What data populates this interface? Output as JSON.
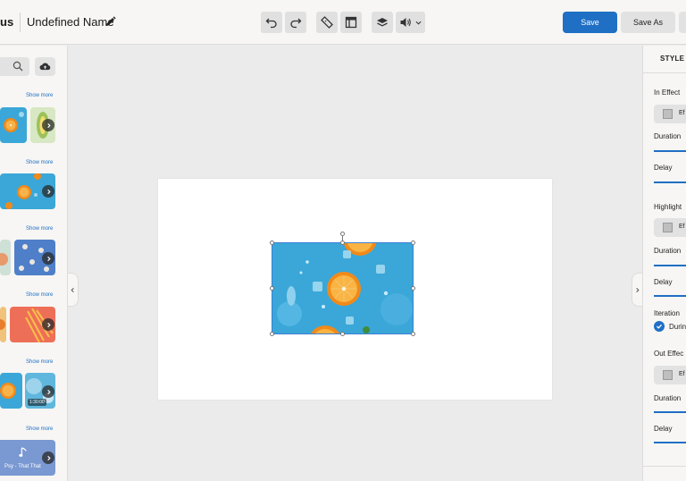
{
  "header": {
    "brand": "us",
    "project_name": "Undefined Name",
    "save_label": "Save",
    "save_as_label": "Save As"
  },
  "toolbar": {
    "icons": [
      "undo-icon",
      "redo-icon",
      "ruler-icon",
      "layout-icon",
      "layers-icon",
      "volume-icon",
      "chevron-down-icon"
    ]
  },
  "left_panel": {
    "show_more": [
      "Show more",
      "Show more",
      "Show more",
      "Show more",
      "Show more",
      "Show more"
    ],
    "video_duration": "1:30:00",
    "music_title": "Psy - That That"
  },
  "right_panel": {
    "tab": "STYLE",
    "in_effect": "In Effect",
    "highlight": "Highlight",
    "out_effect": "Out Effec",
    "effect_btn": "Ef",
    "duration": "Duration",
    "delay": "Delay",
    "iteration": "Iteration",
    "iteration_option": "Durin"
  },
  "colors": {
    "accent": "#1f6fc5",
    "image_bg": "#3aa7d8",
    "orange": "#f08a1a"
  }
}
